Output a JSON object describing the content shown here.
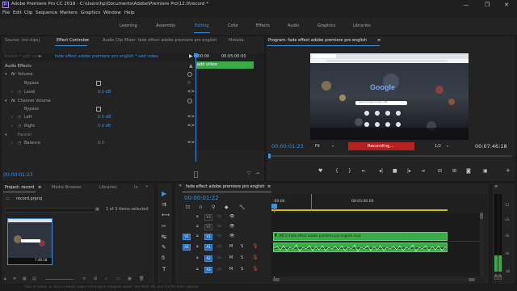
{
  "window": {
    "app_icon": "Pr",
    "title": "Adobe Premiere Pro CC 2018 - C:\\Users\\hp\\Documents\\Adobe\\Premiere Pro\\12.0\\record *",
    "minimize": "—",
    "restore": "❐",
    "close": "✕"
  },
  "menu": [
    "File",
    "Edit",
    "Clip",
    "Sequence",
    "Markers",
    "Graphics",
    "Window",
    "Help"
  ],
  "workspaces": [
    "Learning",
    "Assembly",
    "Editing",
    "Color",
    "Effects",
    "Audio",
    "Graphics",
    "Libraries"
  ],
  "workspace_active": "Editing",
  "effect_controls": {
    "tabs": [
      "Source: (no clips)",
      "Effect Controls",
      "Audio Clip Mixer: fade effect adobe premiere pro english",
      "Metada"
    ],
    "menu_icon": "≡",
    "source_label": "Master * add video",
    "clip_label": "fade effect adobe premiere pro english * add video",
    "ruler_start": ":00:00",
    "ruler_end": "00:05:00:00",
    "clip_bar": "add video",
    "audio_effects": "Audio Effects",
    "fx": "fx",
    "volume": "Volume",
    "bypass": "Bypass",
    "level": "Level",
    "level_value": "0.0 dB",
    "channel_volume": "Channel Volume",
    "left": "Left",
    "left_value": "0.0 dB",
    "right": "Right",
    "right_value": "0.0 dB",
    "panner": "Panner",
    "balance": "Balance",
    "balance_value": "0.0",
    "timecode": "00:00:01:23"
  },
  "program": {
    "title": "Program: fade effect adobe premiere pro english",
    "menu_icon": "≡",
    "timecode": "00:00:01:23",
    "fit": "Fit",
    "recording": "Recording...",
    "ratio": "1/2",
    "duration": "00:07:46:18",
    "preview": {
      "logo": "Google",
      "search_placeholder": "Search Google or type a URL"
    }
  },
  "project": {
    "tabs": [
      "Project: record",
      "Media Browser",
      "Libraries",
      "In"
    ],
    "menu_icon": "≡",
    "file": "record.prproj",
    "selection": "1 of 3 items selected",
    "thumb_duration": "7:46:18"
  },
  "timeline": {
    "title": "fade effect adobe premiere pro english",
    "menu_icon": "≡",
    "close": "×",
    "timecode": "00:00:01:22",
    "ruler": [
      ":00:00",
      "00:05:00:00"
    ],
    "tracks": [
      {
        "id": "V3",
        "src": "",
        "type": "video"
      },
      {
        "id": "V2",
        "src": "",
        "type": "video"
      },
      {
        "id": "V1",
        "src": "V1",
        "type": "video"
      },
      {
        "id": "A1",
        "src": "A1",
        "type": "audio"
      },
      {
        "id": "A2",
        "src": "",
        "type": "audio"
      },
      {
        "id": "A3",
        "src": "",
        "type": "audio"
      }
    ],
    "m_label": "M",
    "s_label": "S",
    "clip_label": "[MC1] fade effect adobe premiere pro english.mp4"
  },
  "audio_meter": {
    "labels": [
      "-12",
      "-24",
      "-36",
      "-48",
      "dB"
    ],
    "solo": [
      "S",
      "S"
    ]
  },
  "status": "Click to select, or click in empty space and drag to marquee select. Use Shift, Alt, and Ctrl for other options.",
  "colors": {
    "accent": "#3f8fd9",
    "clip_green": "#3bab4a",
    "recording_red": "#b52121",
    "video_track": "#2b2b2b"
  }
}
